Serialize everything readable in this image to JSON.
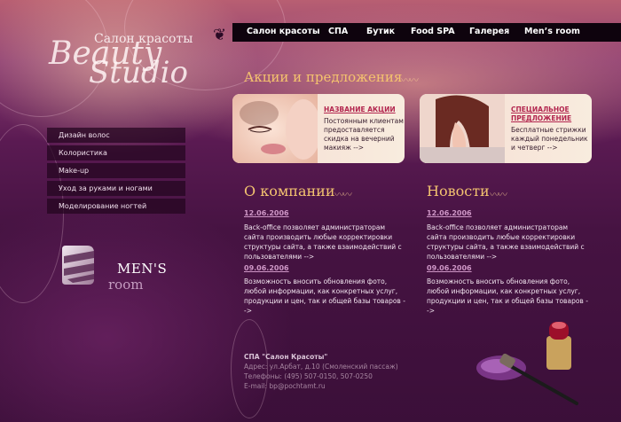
{
  "logo": {
    "subtitle": "Салон красоты",
    "script_line1": "Beauty",
    "script_line2": "Studio"
  },
  "nav": {
    "items": [
      "Салон красоты",
      "СПА",
      "Бутик",
      "Food SPA",
      "Галерея",
      "Men’s room"
    ]
  },
  "sidebar": {
    "items": [
      "Дизайн волос",
      "Колористика",
      "Make-up",
      "Уход за руками и ногами",
      "Моделирование ногтей"
    ]
  },
  "mens_room": {
    "title": "MEN'S",
    "subtitle": "room"
  },
  "promo": {
    "heading": "Акции и предложения",
    "cards": [
      {
        "title": "НАЗВАНИЕ АКЦИИ",
        "text": "Постоянным клиентам предоставляется скидка на вечерний макияж -->"
      },
      {
        "title": "СПЕЦИАЛЬНОЕ ПРЕДЛОЖЕНИЕ",
        "text": "Бесплатные стрижки каждый понедельник и четверг -->"
      }
    ]
  },
  "about": {
    "heading": "О компании",
    "entries": [
      {
        "date": "12.06.2006",
        "text": "Back-office позволяет администраторам сайта производить любые корректировки структуры сайта, а также взаимодействий с пользователями -->"
      },
      {
        "date": "09.06.2006",
        "text": "Возможность вносить обновления фото, любой информации, как конкретных услуг, продукции и цен, так и общей базы товаров -->"
      }
    ]
  },
  "news": {
    "heading": "Новости",
    "entries": [
      {
        "date": "12.06.2006",
        "text": "Back-office позволяет администраторам сайта производить любые корректировки структуры сайта, а также взаимодействий с пользователями -->"
      },
      {
        "date": "09.06.2006",
        "text": "Возможность вносить обновления фото, любой информации, как конкретных услуг, продукции и цен, так и общей базы товаров -->"
      }
    ]
  },
  "footer": {
    "title": "СПА \"Салон Красоты\"",
    "address": "Адрес: ул.Арбат, д.10 (Смоленский пассаж)",
    "phones": "Телефоны: (495) 507-0150, 507-0250",
    "email": "E-mail: bp@pochtamt.ru"
  },
  "colors": {
    "accent": "#f3c370",
    "background": "#3f0f3c",
    "nav_bg": "#0e030d",
    "link": "#b2254e"
  }
}
